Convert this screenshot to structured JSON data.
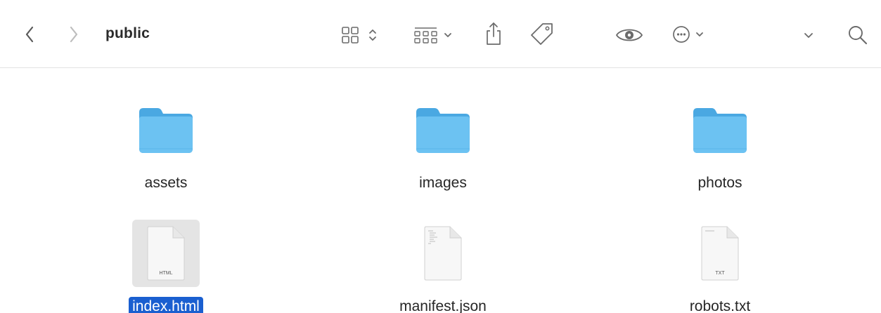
{
  "toolbar": {
    "title": "public",
    "icons": [
      "back-icon",
      "forward-icon",
      "icon-view-icon",
      "group-icon",
      "share-icon",
      "tag-icon",
      "quick-look-icon",
      "more-actions-icon",
      "overflow-chevron-icon",
      "search-icon"
    ]
  },
  "colors": {
    "folder": "#5ab8ec",
    "folder_light": "#7ccaf5",
    "selection": "#1a5fd0",
    "toolbar_icon": "#6b6b6b"
  },
  "items": [
    {
      "name": "assets",
      "kind": "folder",
      "selected": false
    },
    {
      "name": "images",
      "kind": "folder",
      "selected": false
    },
    {
      "name": "photos",
      "kind": "folder",
      "selected": false
    },
    {
      "name": "index.html",
      "kind": "document",
      "badge": "HTML",
      "selected": true
    },
    {
      "name": "manifest.json",
      "kind": "document",
      "badge": "",
      "selected": false
    },
    {
      "name": "robots.txt",
      "kind": "document",
      "badge": "TXT",
      "selected": false
    }
  ]
}
